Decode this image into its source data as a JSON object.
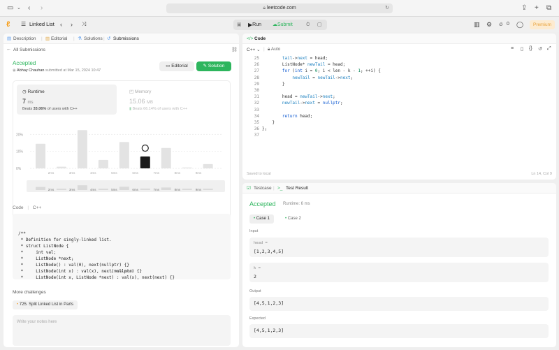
{
  "browser": {
    "url": "leetcode.com"
  },
  "appbar": {
    "problem_title": "Linked List",
    "run": "Run",
    "submit": "Submit",
    "streak": "0",
    "premium": "Premium"
  },
  "left": {
    "tabs": [
      "Description",
      "Editorial",
      "Solutions",
      "Submissions"
    ],
    "all_submissions": "All Submissions",
    "status": "Accepted",
    "user": "Abhay Chauhan",
    "submitted_text": "submitted at Mar 15, 2024 10:47",
    "editorial_btn": "Editorial",
    "solution_btn": "Solution",
    "runtime": {
      "label": "Runtime",
      "value": "7",
      "unit": "ms",
      "beats_prefix": "Beats ",
      "beats_pct": "33.06%",
      "beats_suffix": " of users with C++"
    },
    "memory": {
      "label": "Memory",
      "value": "15.06",
      "unit": "MB",
      "beats_prefix": "Beats ",
      "beats_pct": "66.14%",
      "beats_suffix": " of users with C++"
    },
    "code_label": "Code",
    "code_lang": "C++",
    "view_more": "View more",
    "more_challenges": "More challenges",
    "challenge": "725. Split Linked List in Parts",
    "notes_placeholder": "Write your notes here"
  },
  "chart_data": {
    "type": "bar",
    "categories": [
      "2ms",
      "3ms",
      "4ms",
      "5ms",
      "6ms",
      "7ms",
      "8ms",
      "9ms"
    ],
    "values": [
      14.5,
      1,
      22.5,
      5,
      15.5,
      7,
      12,
      0.5,
      2.5
    ],
    "yticks": [
      "20%",
      "10%",
      "0%"
    ],
    "ylim": [
      0,
      30
    ],
    "highlight": "7ms",
    "minimap_labels": [
      "2ms",
      "3ms",
      "4ms",
      "5ms",
      "6ms",
      "7ms",
      "8ms",
      "9ms"
    ]
  },
  "submitted_code": [
    "/**",
    " * Definition for singly-linked list.",
    " * struct ListNode {",
    " *     int val;",
    " *     ListNode *next;",
    " *     ListNode() : val(0), next(nullptr) {}",
    " *     ListNode(int x) : val(x), next(nullptr) {}",
    " *     ListNode(int x, ListNode *next) : val(x), next(next) {}"
  ],
  "editor": {
    "title": "Code",
    "lang": "C++",
    "mode": "Auto",
    "line_numbers": [
      "25",
      "26",
      "27",
      "28",
      "29",
      "30",
      "31",
      "32",
      "33",
      "34",
      "35",
      "36",
      "37"
    ],
    "saved": "Saved to local",
    "cursor": "Ln 14, Col 9"
  },
  "result": {
    "tab_testcase": "Testcase",
    "tab_result": "Test Result",
    "status": "Accepted",
    "runtime": "Runtime: 6 ms",
    "case1": "Case 1",
    "case2": "Case 2",
    "input_label": "Input",
    "head_label": "head =",
    "head_value": "[1,2,3,4,5]",
    "k_label": "k =",
    "k_value": "2",
    "output_label": "Output",
    "output_value": "[4,5,1,2,3]",
    "expected_label": "Expected",
    "expected_value": "[4,5,1,2,3]"
  }
}
